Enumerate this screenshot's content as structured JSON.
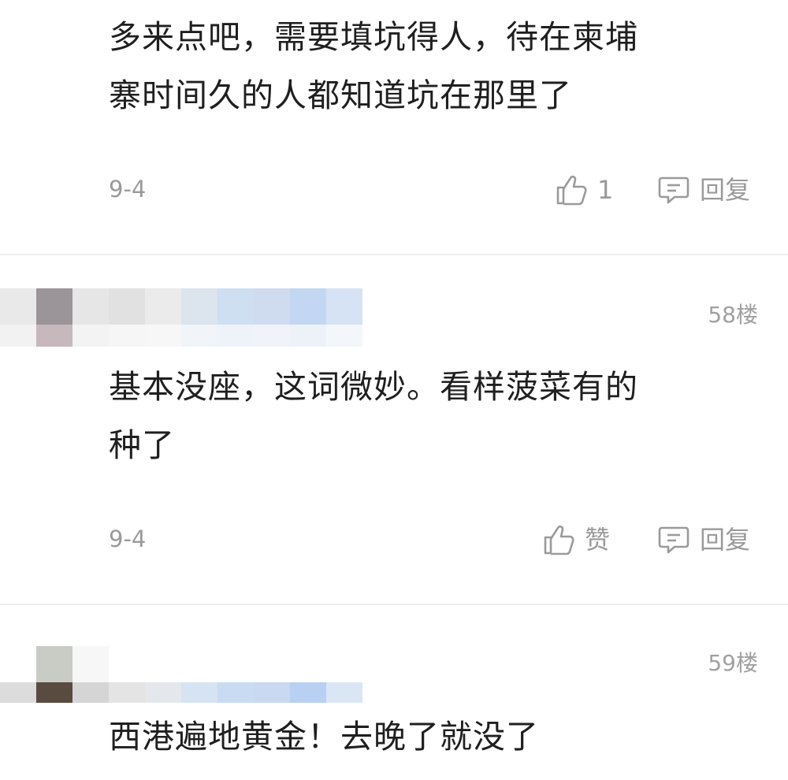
{
  "comments": [
    {
      "text_line1": "多来点吧，需要填坑得人，待在柬埔",
      "text_line2": "寨时间久的人都知道坑在那里了",
      "date": "9-4",
      "like_label": "1",
      "reply_label": "回复"
    },
    {
      "floor": "58楼",
      "text_line1": "基本没座，这词微妙。看样菠菜有的",
      "text_line2": "种了",
      "date": "9-4",
      "like_label": "赞",
      "reply_label": "回复"
    },
    {
      "floor": "59楼",
      "text_line1": "西港遍地黄金！去晚了就没了"
    }
  ],
  "icons": {
    "like": "thumbs-up-icon",
    "reply": "comment-bubble-icon"
  },
  "colors": {
    "text": "#1f1f1f",
    "muted": "#9a9a9a",
    "divider": "#eeeeee"
  }
}
